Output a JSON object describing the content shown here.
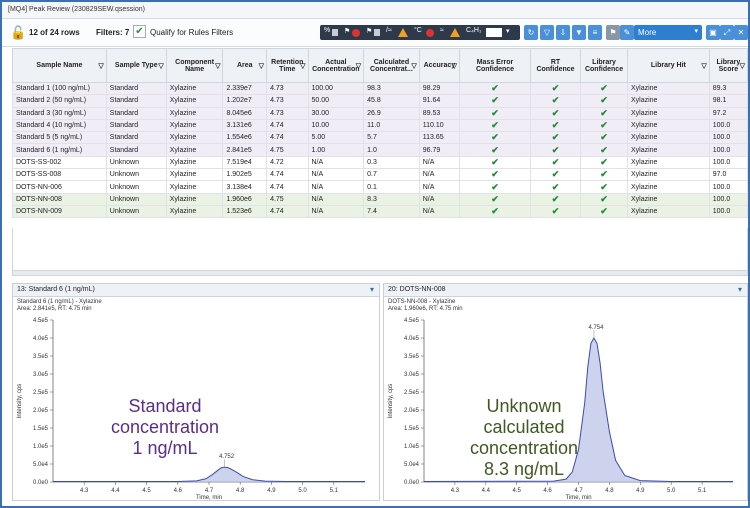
{
  "window": {
    "title": "[MQ4] Peak Review (230829SEW.qsession)"
  },
  "toolbar": {
    "rows_label": "12 of 24 rows",
    "filters_label": "Filters: 7",
    "qualify_label": "Qualify for Rules Filters",
    "more_label": "More",
    "formula_label": "C₄H₁"
  },
  "table": {
    "headers": [
      "Sample Name",
      "Sample Type",
      "Component Name",
      "Area",
      "Retention Time",
      "Actual Concentration",
      "Calculated Concentrat...",
      "Accuracy",
      "Mass Error Confidence",
      "RT Confidence",
      "Library Confidence",
      "Library Hit",
      "Library Score"
    ],
    "rows": [
      {
        "style": "purple",
        "cells": [
          "Standard 1 (100 ng/mL)",
          "Standard",
          "Xylazine",
          "2.339e7",
          "4.73",
          "100.00",
          "98.3",
          "98.29",
          "✔",
          "✔",
          "✔",
          "Xylazine",
          "89.3"
        ]
      },
      {
        "style": "purple",
        "cells": [
          "Standard 2 (50 ng/mL)",
          "Standard",
          "Xylazine",
          "1.202e7",
          "4.73",
          "50.00",
          "45.8",
          "91.64",
          "✔",
          "✔",
          "✔",
          "Xylazine",
          "98.1"
        ]
      },
      {
        "style": "purple",
        "cells": [
          "Standard 3 (30 ng/mL)",
          "Standard",
          "Xylazine",
          "8.045e6",
          "4.73",
          "30.00",
          "26.9",
          "89.53",
          "✔",
          "✔",
          "✔",
          "Xylazine",
          "97.2"
        ]
      },
      {
        "style": "purple",
        "cells": [
          "Standard 4 (10 ng/mL)",
          "Standard",
          "Xylazine",
          "3.131e6",
          "4.74",
          "10.00",
          "11.0",
          "110.10",
          "✔",
          "✔",
          "✔",
          "Xylazine",
          "100.0"
        ]
      },
      {
        "style": "purple",
        "cells": [
          "Standard 5 (5 ng/mL)",
          "Standard",
          "Xylazine",
          "1.554e6",
          "4.74",
          "5.00",
          "5.7",
          "113.65",
          "✔",
          "✔",
          "✔",
          "Xylazine",
          "100.0"
        ]
      },
      {
        "style": "purple",
        "cells": [
          "Standard 6 (1 ng/mL)",
          "Standard",
          "Xylazine",
          "2.841e5",
          "4.75",
          "1.00",
          "1.0",
          "96.79",
          "✔",
          "✔",
          "✔",
          "Xylazine",
          "100.0"
        ]
      },
      {
        "style": "white",
        "cells": [
          "DOTS-SS-002",
          "Unknown",
          "Xylazine",
          "7.519e4",
          "4.72",
          "N/A",
          "0.3",
          "N/A",
          "✔",
          "✔",
          "✔",
          "Xylazine",
          "100.0"
        ]
      },
      {
        "style": "white",
        "cells": [
          "DOTS-SS-008",
          "Unknown",
          "Xylazine",
          "1.902e5",
          "4.74",
          "N/A",
          "0.7",
          "N/A",
          "✔",
          "✔",
          "✔",
          "Xylazine",
          "97.0"
        ]
      },
      {
        "style": "white",
        "cells": [
          "DOTS-NN-006",
          "Unknown",
          "Xylazine",
          "3.138e4",
          "4.74",
          "N/A",
          "0.1",
          "N/A",
          "✔",
          "✔",
          "✔",
          "Xylazine",
          "100.0"
        ]
      },
      {
        "style": "green",
        "cells": [
          "DOTS-NN-008",
          "Unknown",
          "Xylazine",
          "1.960e6",
          "4.75",
          "N/A",
          "8.3",
          "N/A",
          "✔",
          "✔",
          "✔",
          "Xylazine",
          "100.0"
        ]
      },
      {
        "style": "green",
        "cells": [
          "DOTS-NN-009",
          "Unknown",
          "Xylazine",
          "1.523e6",
          "4.74",
          "N/A",
          "7.4",
          "N/A",
          "✔",
          "✔",
          "✔",
          "Xylazine",
          "100.0"
        ]
      }
    ]
  },
  "left_pane": {
    "header": "13: Standard 6 (1 ng/mL)",
    "info_line1": "Standard 6 (1 ng/mL) - Xylazine",
    "info_line2": "Area: 2.841e5, RT: 4.75 min",
    "overlay_text": [
      "Standard",
      "concentration",
      "1 ng/mL"
    ]
  },
  "right_pane": {
    "header": "20: DOTS-NN-008",
    "info_line1": "DOTS-NN-008 - Xylazine",
    "info_line2": "Area: 1.960e6, RT: 4.75 min",
    "overlay_text": [
      "Unknown",
      "calculated",
      "concentration",
      "8.3 ng/mL"
    ]
  },
  "colors": {
    "accent": "#2f7fd1",
    "check": "#1f8a3a",
    "peak_fill": "#b8bfe6",
    "peak_stroke": "#3d4bb0",
    "overlay_left": "#5b2d8a",
    "overlay_right": "#3e5a22"
  },
  "chart_data": [
    {
      "type": "line",
      "xlabel": "Time, min",
      "ylabel": "Intensity, cps",
      "xlim": [
        4.2,
        5.2
      ],
      "ylim": [
        0,
        450000
      ],
      "xticks": [
        4.3,
        4.4,
        4.5,
        4.6,
        4.7,
        4.8,
        4.9,
        5.0,
        5.1
      ],
      "yticks": [
        0,
        50000,
        100000,
        150000,
        200000,
        250000,
        300000,
        350000,
        400000,
        450000
      ],
      "xtick_labels": [
        "4.3",
        "4.4",
        "4.5",
        "4.6",
        "4.7",
        "4.8",
        "4.9",
        "5.0",
        "5.1"
      ],
      "ytick_labels": [
        "0.0e0",
        "5.0e4",
        "1.0e5",
        "1.5e5",
        "2.0e5",
        "2.5e5",
        "3.0e5",
        "3.5e5",
        "4.0e5",
        "4.5e5"
      ],
      "peak_label": "4.752",
      "series": [
        {
          "x": [
            4.2,
            4.6,
            4.66,
            4.69,
            4.71,
            4.73,
            4.74,
            4.75,
            4.76,
            4.77,
            4.79,
            4.81,
            4.84,
            4.88,
            4.95,
            5.2
          ],
          "values": [
            1500,
            1500,
            3000,
            9000,
            20000,
            34000,
            40000,
            41000,
            40000,
            36000,
            26000,
            15000,
            6500,
            2500,
            1500,
            1500
          ]
        }
      ]
    },
    {
      "type": "line",
      "xlabel": "Time, min",
      "ylabel": "Intensity, cps",
      "xlim": [
        4.2,
        5.2
      ],
      "ylim": [
        0,
        450000
      ],
      "xticks": [
        4.3,
        4.4,
        4.5,
        4.6,
        4.7,
        4.8,
        4.9,
        5.0,
        5.1
      ],
      "yticks": [
        0,
        50000,
        100000,
        150000,
        200000,
        250000,
        300000,
        350000,
        400000,
        450000
      ],
      "xtick_labels": [
        "4.3",
        "4.4",
        "4.5",
        "4.6",
        "4.7",
        "4.8",
        "4.9",
        "5.0",
        "5.1"
      ],
      "ytick_labels": [
        "0.0e0",
        "5.0e4",
        "1.0e5",
        "1.5e5",
        "2.0e5",
        "2.5e5",
        "3.0e5",
        "3.5e5",
        "4.0e5",
        "4.5e5"
      ],
      "peak_label": "4.754",
      "series": [
        {
          "x": [
            4.2,
            4.62,
            4.66,
            4.68,
            4.7,
            4.72,
            4.73,
            4.74,
            4.75,
            4.76,
            4.77,
            4.78,
            4.8,
            4.82,
            4.85,
            4.9,
            5.0,
            5.2
          ],
          "values": [
            1500,
            2500,
            8000,
            28000,
            90000,
            220000,
            320000,
            385000,
            400000,
            385000,
            330000,
            250000,
            140000,
            60000,
            18000,
            4000,
            1500,
            1500
          ]
        }
      ]
    }
  ]
}
